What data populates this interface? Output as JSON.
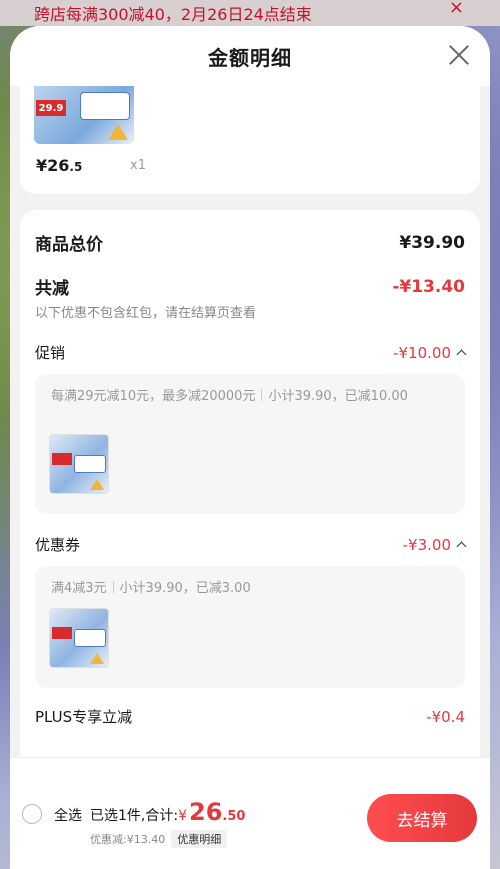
{
  "background": {
    "banner_text": "跨店每满300减40，2月26日24点结束",
    "banner_close": "×"
  },
  "sheet": {
    "title": "金额明细"
  },
  "product": {
    "price_main": "¥26",
    "price_decimal": ".5",
    "quantity": "x1"
  },
  "summary": {
    "goods_total_label": "商品总价",
    "goods_total_value": "¥39.90",
    "total_reduce_label": "共减",
    "total_reduce_value": "-¥13.40",
    "note": "以下优惠不包含红包，请在结算页查看",
    "promo": {
      "label": "促销",
      "value": "-¥10.00",
      "desc_part1": "每满29元减10元，最多减20000元",
      "desc_part2": "小计39.90，已减10.00"
    },
    "coupon": {
      "label": "优惠券",
      "value": "-¥3.00",
      "desc_part1": "满4减3元",
      "desc_part2": "小计39.90，已减3.00"
    },
    "plus": {
      "label": "PLUS专享立减",
      "value": "-¥0.4"
    }
  },
  "bottom_bar": {
    "select_all": "全选",
    "selected_text": "已选1件,合计:",
    "total_yen": "¥",
    "total_int": "26",
    "total_dec": ".50",
    "discount_text": "优惠减:¥13.40",
    "detail_chip": "优惠明细",
    "checkout": "去结算"
  },
  "colors": {
    "accent_red": "#e4393c",
    "sheet_bg": "#f2f2f2"
  }
}
